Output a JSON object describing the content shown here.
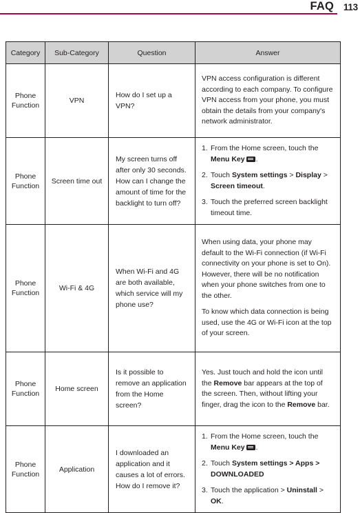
{
  "header": {
    "title": "FAQ",
    "page_number": "113",
    "rule_color": "#a5054a"
  },
  "table": {
    "columns": [
      "Category",
      "Sub-Category",
      "Question",
      "Answer"
    ],
    "header_bg": "#d2d2d2",
    "rows": [
      {
        "category": "Phone Function",
        "sub_category": "VPN",
        "question": "How do I set up a VPN?",
        "answer_plain": "VPN access configuration is different according to each company. To configure VPN access from your phone, you must obtain the details from your company's network administrator."
      },
      {
        "category": "Phone Function",
        "sub_category": "Screen time out",
        "question": "My screen turns off after only 30 seconds. How can I change the amount of time for the backlight to turn off?",
        "answer_steps": [
          "1. From the Home screen, touch the Menu Key [menu-key-icon].",
          "2. Touch System settings > Display > Screen timeout.",
          "3. Touch the preferred screen backlight timeout time."
        ]
      },
      {
        "category": "Phone Function",
        "sub_category": "Wi-Fi & 4G",
        "question": "When Wi-Fi and 4G are both available, which service will my phone use?",
        "answer_paragraphs": [
          "When using data, your phone may default to the Wi-Fi connection (if Wi-Fi connectivity on your phone is set to On). However, there will be no notification when your phone switches from one to the other.",
          "To know which data connection is being used, use the 4G or Wi-Fi icon at the top of your screen."
        ]
      },
      {
        "category": "Phone Function",
        "sub_category": "Home screen",
        "question": "Is it possible to remove an application from the Home screen?",
        "answer_plain": "Yes. Just touch and hold the icon until the Remove bar appears at the top of the screen. Then, without lifting your finger, drag the icon to the Remove bar."
      },
      {
        "category": "Phone Function",
        "sub_category": "Application",
        "question": "I downloaded an application and it causes a lot of errors. How do I remove it?",
        "answer_steps": [
          "1. From the Home screen, touch the Menu Key [menu-key-icon].",
          "2. Touch System settings > Apps > DOWNLOADED",
          "3. Touch the application > Uninstall > OK."
        ]
      }
    ]
  }
}
